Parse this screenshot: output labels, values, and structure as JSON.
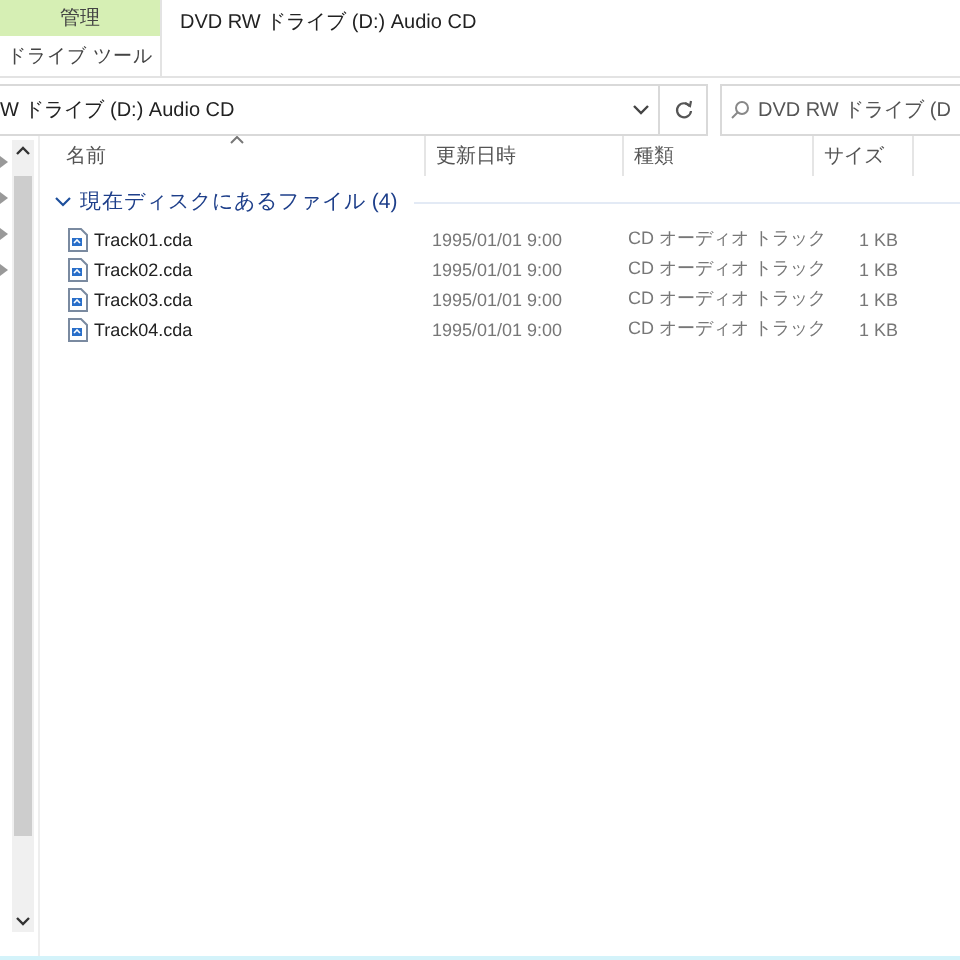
{
  "ribbon": {
    "context_tab": "管理",
    "context_group": "ドライブ ツール",
    "title": "DVD RW ドライブ (D:) Audio CD"
  },
  "address_bar": {
    "path": "W ドライブ (D:) Audio CD"
  },
  "search": {
    "placeholder": "DVD RW ドライブ (D"
  },
  "columns": [
    {
      "label": "名前",
      "sorted": true
    },
    {
      "label": "更新日時",
      "sorted": false
    },
    {
      "label": "種類",
      "sorted": false
    },
    {
      "label": "サイズ",
      "sorted": false
    }
  ],
  "group": {
    "label": "現在ディスクにあるファイル (4)",
    "expanded": true
  },
  "files": [
    {
      "name": "Track01.cda",
      "modified": "1995/01/01 9:00",
      "type": "CD オーディオ トラック",
      "size": "1 KB"
    },
    {
      "name": "Track02.cda",
      "modified": "1995/01/01 9:00",
      "type": "CD オーディオ トラック",
      "size": "1 KB"
    },
    {
      "name": "Track03.cda",
      "modified": "1995/01/01 9:00",
      "type": "CD オーディオ トラック",
      "size": "1 KB"
    },
    {
      "name": "Track04.cda",
      "modified": "1995/01/01 9:00",
      "type": "CD オーディオ トラック",
      "size": "1 KB"
    }
  ]
}
